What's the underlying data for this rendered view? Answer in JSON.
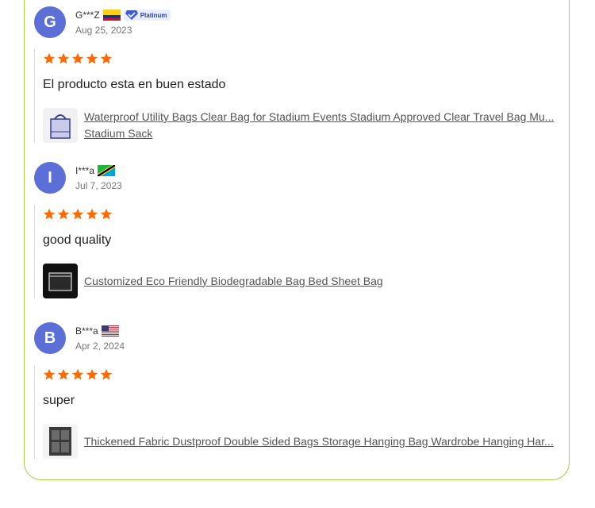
{
  "reviews": [
    {
      "initial": "G",
      "name": "G***Z",
      "country_flag": "colombia-flag",
      "badge": "Platinum",
      "date": "Aug 25, 2023",
      "rating": 5,
      "text": "El producto esta en buen estado",
      "product": "Waterproof Utility Bags Clear Bag for Stadium Events Stadium Approved Clear Travel Bag Mu... Stadium Sack"
    },
    {
      "initial": "I",
      "name": "I***a",
      "country_flag": "tanzania-flag",
      "date": "Jul 7, 2023",
      "rating": 5,
      "text": "good quality",
      "product": "Customized Eco Friendly Biodegradable Bag Bed Sheet Bag"
    },
    {
      "initial": "B",
      "name": "B***a",
      "country_flag": "usa-flag",
      "date": "Apr 2, 2024",
      "rating": 5,
      "text": "super",
      "product": "Thickened Fabric Dustproof Double Sided Bags Storage Hanging Bag Wardrobe Hanging Har..."
    }
  ],
  "colors": {
    "accent_border": "#a6cf45",
    "avatar": "#5b6fd6",
    "star": "#ff6a00"
  }
}
